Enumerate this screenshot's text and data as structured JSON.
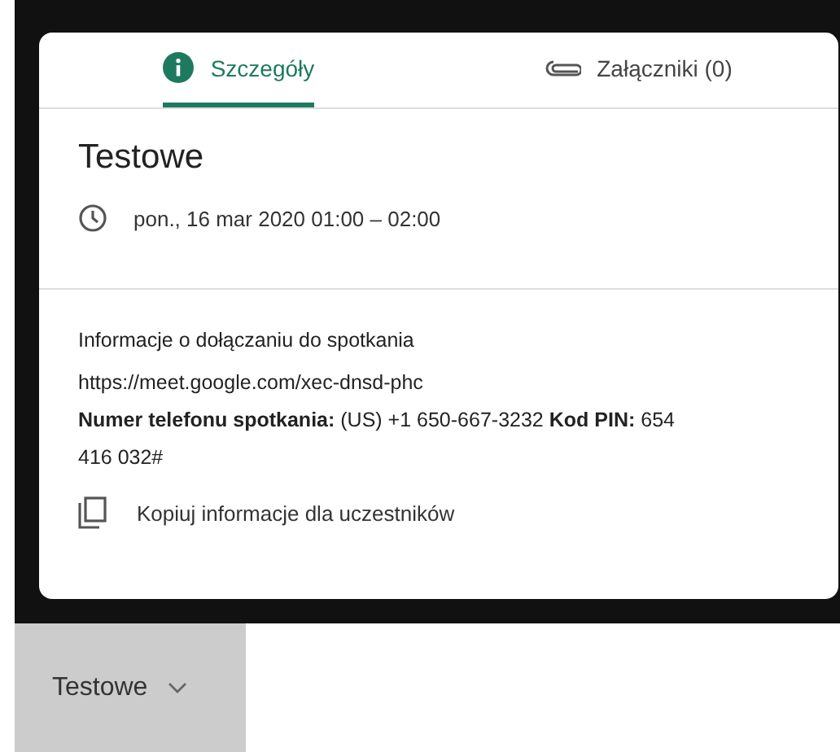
{
  "tabs": [
    {
      "label": "Szczegóły",
      "selected": true
    },
    {
      "label": "Załączniki (0)",
      "selected": false
    }
  ],
  "event": {
    "title": "Testowe",
    "datetime": "pon., 16 mar 2020 01:00 – 02:00"
  },
  "joining": {
    "heading": "Informacje o dołączaniu do spotkania",
    "link": "https://meet.google.com/xec-dnsd-phc",
    "phone": "**Numer telefonu spotkania:** (US) +1 650-667-3232  **Kod PIN:** 654 416 032#",
    "copy_action": "Kopiuj informacje dla uczestników"
  },
  "bottom_tab": {
    "label": "Testowe"
  }
}
